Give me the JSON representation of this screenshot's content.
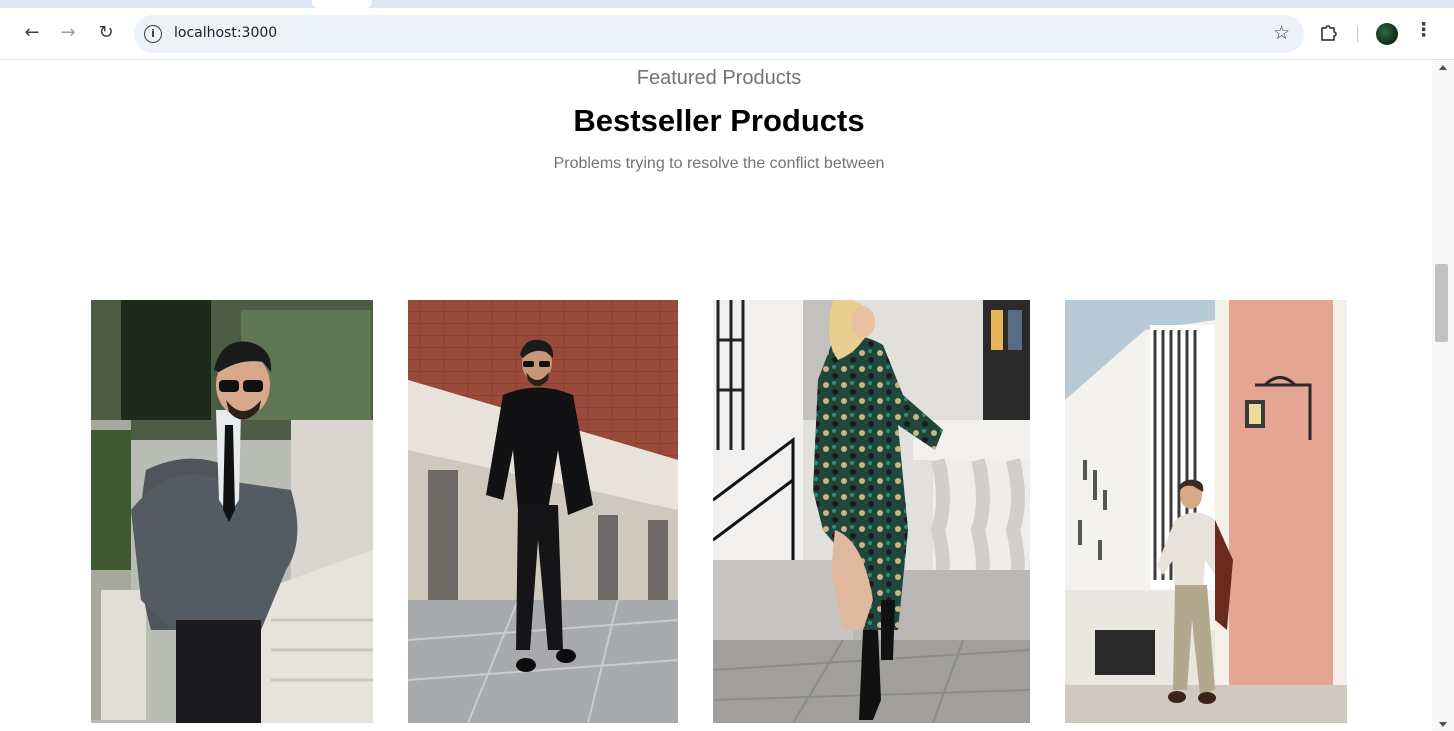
{
  "browser": {
    "url": "localhost:3000",
    "icons": [
      "back-arrow-icon",
      "forward-arrow-icon",
      "reload-icon",
      "site-info-icon",
      "bookmark-star-icon",
      "extensions-puzzle-icon",
      "profile-avatar",
      "more-menu-icon"
    ]
  },
  "section": {
    "eyebrow": "Featured Products",
    "title": "Bestseller Products",
    "subtitle": "Problems trying to resolve the conflict between"
  },
  "products": [
    {
      "image": "man-grey-blazer-stairs-photo"
    },
    {
      "image": "man-black-suit-walking-photo"
    },
    {
      "image": "woman-green-print-dress-photo"
    },
    {
      "image": "man-suspenders-pink-wall-photo"
    }
  ],
  "colors": {
    "omnibox_bg": "#edf1f9",
    "eyebrow_text": "#737373",
    "title_text": "#000000"
  }
}
